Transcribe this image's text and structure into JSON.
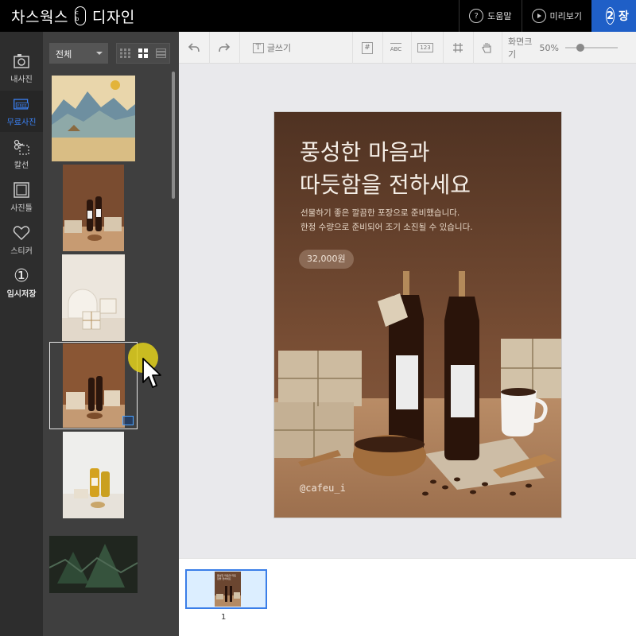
{
  "app": {
    "brand_left": "차스웍스",
    "brand_mark": "c b",
    "brand_right": "디자인"
  },
  "topbar": {
    "help_label": "도움말",
    "preview_label": "미리보기",
    "step_number": "2",
    "step_label": "장"
  },
  "rail": [
    {
      "label": "내사진",
      "icon": "photo-frame-icon"
    },
    {
      "label": "무료사진",
      "icon": "free-photo-icon"
    },
    {
      "label": "칼선",
      "icon": "scissors-icon"
    },
    {
      "label": "사진틀",
      "icon": "photo-frame-border-icon"
    },
    {
      "label": "스티커",
      "icon": "heart-icon"
    },
    {
      "label": "임시저장",
      "icon": "number-one-icon",
      "glyph": "①"
    }
  ],
  "panel": {
    "filter_value": "전체",
    "photos": [
      "landscape-painting",
      "coffee-bottles",
      "gift-boxes",
      "coffee-gift-set",
      "honey-bottles",
      "pine-tree"
    ]
  },
  "toolbar": {
    "text_tool_label": "글쓰기",
    "text_icon_glyph": "T",
    "hash_glyph": "#",
    "abc_label": "ABC",
    "num_label": "123",
    "zoom_label": "화면크기",
    "zoom_value": "50%",
    "zoom_level": 0.25
  },
  "poster": {
    "title_line1": "풍성한 마음과",
    "title_line2": "따듯함을 전하세요",
    "sub_line1": "선물하기 좋은 깔끔한 포장으로 준비했습니다.",
    "sub_line2": "한정 수량으로 준비되어 조기 소진될 수 있습니다.",
    "price": "32,000원",
    "handle": "@cafeu_i"
  },
  "pages": {
    "current": "1",
    "mini_title": "풍성한 마음과 따듯함을 전하세요"
  },
  "colors": {
    "accent": "#1f5fc7",
    "active_rail": "#3b82f6",
    "poster_bg": "#6b4630",
    "cursor_highlight": "#decd1e"
  }
}
